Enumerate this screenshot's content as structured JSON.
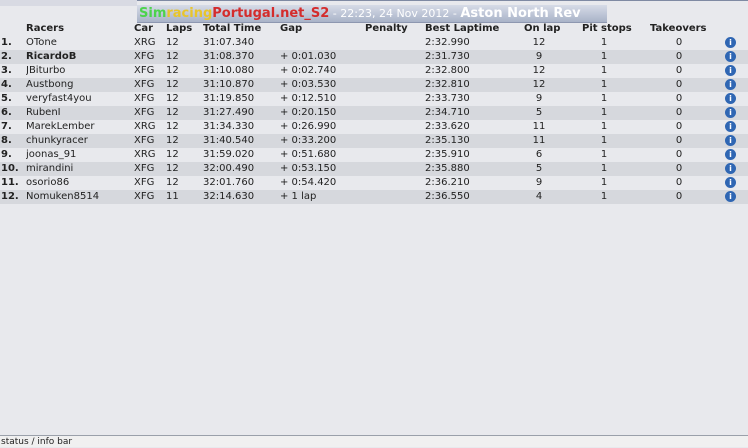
{
  "header": {
    "brand": [
      "Sim",
      "racing",
      "Portugal.net_S2"
    ],
    "timestamp": " - 22:23, 24 Nov 2012 - ",
    "track": "Aston North Rev"
  },
  "columns": [
    "Racers",
    "Car",
    "Laps",
    "Total Time",
    "Gap",
    "Penalty",
    "Best Laptime",
    "On lap",
    "Pit stops",
    "Takeovers"
  ],
  "rows": [
    {
      "pos": "1.",
      "name": "OTone",
      "car": "XRG",
      "laps": "12",
      "total": "31:07.340",
      "gap": "",
      "penalty": "",
      "best": "2:32.990",
      "onlap": "12",
      "pits": "1",
      "takeovers": "0",
      "bold": false
    },
    {
      "pos": "2.",
      "name": "RicardoB",
      "car": "XFG",
      "laps": "12",
      "total": "31:08.370",
      "gap": "+ 0:01.030",
      "penalty": "",
      "best": "2:31.730",
      "onlap": "9",
      "pits": "1",
      "takeovers": "0",
      "bold": true
    },
    {
      "pos": "3.",
      "name": "JBiturbo",
      "car": "XFG",
      "laps": "12",
      "total": "31:10.080",
      "gap": "+ 0:02.740",
      "penalty": "",
      "best": "2:32.800",
      "onlap": "12",
      "pits": "1",
      "takeovers": "0",
      "bold": false
    },
    {
      "pos": "4.",
      "name": "Austbong",
      "car": "XFG",
      "laps": "12",
      "total": "31:10.870",
      "gap": "+ 0:03.530",
      "penalty": "",
      "best": "2:32.810",
      "onlap": "12",
      "pits": "1",
      "takeovers": "0",
      "bold": false
    },
    {
      "pos": "5.",
      "name": "veryfast4you",
      "car": "XFG",
      "laps": "12",
      "total": "31:19.850",
      "gap": "+ 0:12.510",
      "penalty": "",
      "best": "2:33.730",
      "onlap": "9",
      "pits": "1",
      "takeovers": "0",
      "bold": false
    },
    {
      "pos": "6.",
      "name": "RubenI",
      "car": "XFG",
      "laps": "12",
      "total": "31:27.490",
      "gap": "+ 0:20.150",
      "penalty": "",
      "best": "2:34.710",
      "onlap": "5",
      "pits": "1",
      "takeovers": "0",
      "bold": false
    },
    {
      "pos": "7.",
      "name": "MarekLember",
      "car": "XRG",
      "laps": "12",
      "total": "31:34.330",
      "gap": "+ 0:26.990",
      "penalty": "",
      "best": "2:33.620",
      "onlap": "11",
      "pits": "1",
      "takeovers": "0",
      "bold": false
    },
    {
      "pos": "8.",
      "name": "chunkyracer",
      "car": "XFG",
      "laps": "12",
      "total": "31:40.540",
      "gap": "+ 0:33.200",
      "penalty": "",
      "best": "2:35.130",
      "onlap": "11",
      "pits": "1",
      "takeovers": "0",
      "bold": false
    },
    {
      "pos": "9.",
      "name": "joonas_91",
      "car": "XRG",
      "laps": "12",
      "total": "31:59.020",
      "gap": "+ 0:51.680",
      "penalty": "",
      "best": "2:35.910",
      "onlap": "6",
      "pits": "1",
      "takeovers": "0",
      "bold": false
    },
    {
      "pos": "10.",
      "name": "mirandini",
      "car": "XFG",
      "laps": "12",
      "total": "32:00.490",
      "gap": "+ 0:53.150",
      "penalty": "",
      "best": "2:35.880",
      "onlap": "5",
      "pits": "1",
      "takeovers": "0",
      "bold": false
    },
    {
      "pos": "11.",
      "name": "osorio86",
      "car": "XFG",
      "laps": "12",
      "total": "32:01.760",
      "gap": "+ 0:54.420",
      "penalty": "",
      "best": "2:36.210",
      "onlap": "9",
      "pits": "1",
      "takeovers": "0",
      "bold": false
    },
    {
      "pos": "12.",
      "name": "Nomuken8514",
      "car": "XFG",
      "laps": "11",
      "total": "32:14.630",
      "gap": "+ 1 lap",
      "penalty": "",
      "best": "2:36.550",
      "onlap": "4",
      "pits": "1",
      "takeovers": "0",
      "bold": false
    }
  ],
  "info_icon": "info-icon",
  "status_bar": "status / info bar",
  "colors": {
    "brand_green": "#4cd34c",
    "brand_yellow": "#e8c52a",
    "brand_red": "#d42c2c",
    "info_blue": "#2f66b3",
    "alt_row": "#d6d8dd"
  }
}
